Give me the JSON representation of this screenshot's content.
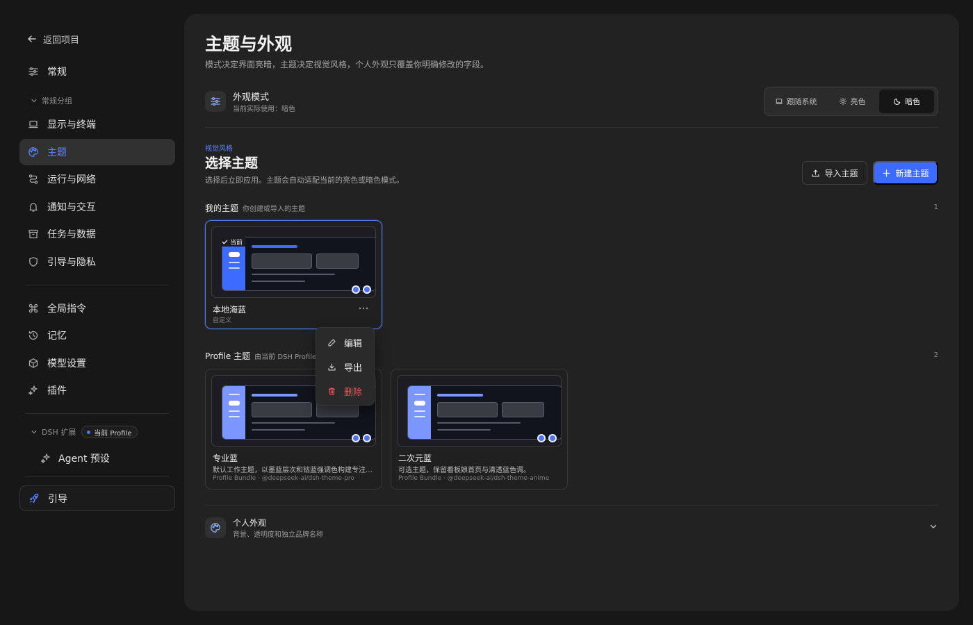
{
  "sidebar": {
    "back_label": "返回项目",
    "general_label": "常规",
    "group_label": "常规分组",
    "items": [
      {
        "label": "显示与终端"
      },
      {
        "label": "主题"
      },
      {
        "label": "运行与网络"
      },
      {
        "label": "通知与交互"
      },
      {
        "label": "任务与数据"
      },
      {
        "label": "引导与隐私"
      }
    ],
    "items2": [
      {
        "label": "全局指令"
      },
      {
        "label": "记忆"
      },
      {
        "label": "模型设置"
      },
      {
        "label": "插件"
      }
    ],
    "extension_label": "DSH 扩展",
    "profile_badge": "当前 Profile",
    "agent_preset_label": "Agent 预设",
    "guide_label": "引导"
  },
  "page": {
    "title": "主题与外观",
    "subtitle": "模式决定界面亮暗，主题决定视觉风格，个人外观只覆盖你明确修改的字段。"
  },
  "appearance_mode": {
    "title": "外观模式",
    "desc": "当前实际使用：暗色",
    "options": [
      "跟随系统",
      "亮色",
      "暗色"
    ],
    "selected": "暗色"
  },
  "theme_section": {
    "eyebrow": "视觉风格",
    "title": "选择主题",
    "desc": "选择后立即应用。主题会自动适配当前的亮色或暗色模式。",
    "import_label": "导入主题",
    "new_label": "新建主题"
  },
  "my_themes": {
    "title": "我的主题",
    "subtitle": "你创建或导入的主题",
    "count": "1",
    "cards": [
      {
        "name": "本地海蓝",
        "sub": "自定义",
        "current_label": "当前",
        "accent": "#3d6bff"
      }
    ]
  },
  "profile_themes": {
    "title": "Profile 主题",
    "subtitle": "由当前 DSH Profile 提供",
    "count": "2",
    "cards": [
      {
        "name": "专业蓝",
        "desc": "默认工作主题，以墨蓝层次和钴蓝强调色构建专注的工作界面。",
        "meta": "Profile Bundle · @deepseek-ai/dsh-theme-pro",
        "accent": "#6f8fff"
      },
      {
        "name": "二次元蓝",
        "desc": "可选主题，保留看板娘首页与清透蓝色调。",
        "meta": "Profile Bundle · @deepseek-ai/dsh-theme-anime",
        "accent": "#6f8fff"
      }
    ]
  },
  "context_menu": {
    "edit": "编辑",
    "export": "导出",
    "delete": "删除"
  },
  "personal": {
    "title": "个人外观",
    "desc": "背景、透明度和独立品牌名称"
  },
  "colors": {
    "accent": "#3d6bff",
    "danger": "#f0525a",
    "background": "#171717",
    "panel": "#222222"
  }
}
